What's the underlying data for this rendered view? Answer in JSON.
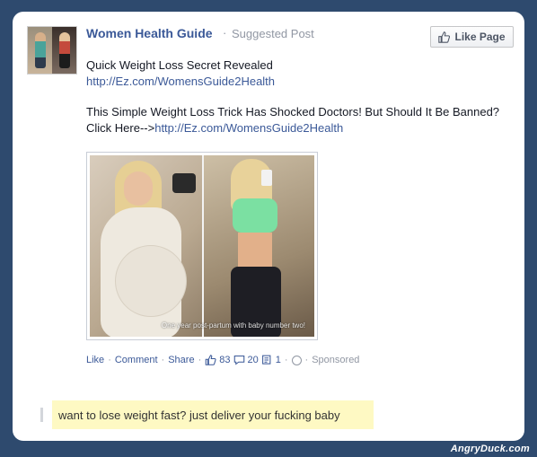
{
  "post": {
    "page_name": "Women Health Guide",
    "separator": "·",
    "post_type": "Suggested Post",
    "like_page_label": "Like Page",
    "line1": "Quick Weight Loss Secret Revealed",
    "link1": "http://Ez.com/WomensGuide2Health",
    "line2": "This Simple Weight Loss Trick Has Shocked Doctors! But Should It Be Banned? Click Here-->",
    "link2": "http://Ez.com/WomensGuide2Health",
    "photo_caption": "One year post-partum with baby number two!",
    "actions": {
      "like": "Like",
      "comment": "Comment",
      "share": "Share",
      "likes_count": "83",
      "comments_count": "20",
      "shares_count": "1",
      "sponsored": "Sponsored"
    }
  },
  "comment": {
    "text": "want to lose weight fast? just deliver your fucking baby"
  },
  "watermark": "AngryDuck.com",
  "colors": {
    "background": "#2e4a6e",
    "link": "#3b5998",
    "meta": "#9197a3",
    "highlight": "#fef9c3"
  }
}
